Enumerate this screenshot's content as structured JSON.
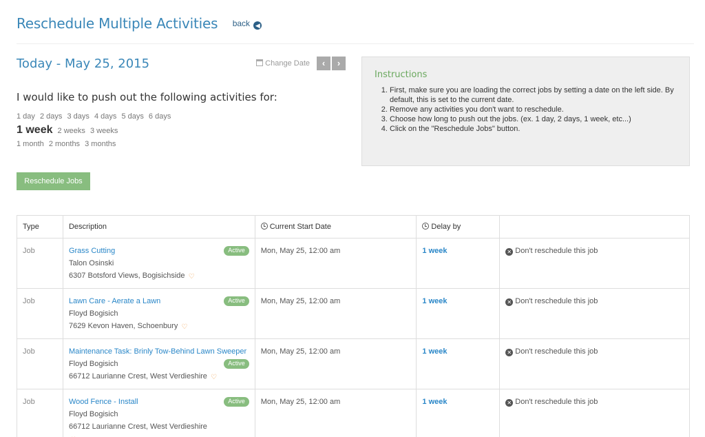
{
  "header": {
    "title": "Reschedule Multiple Activities",
    "back_label": "back"
  },
  "date_section": {
    "title": "Today - May 25, 2015",
    "change_date_label": "Change Date",
    "prev_glyph": "‹",
    "next_glyph": "›"
  },
  "prompt": "I would like to push out the following activities for:",
  "delay_options": {
    "days": [
      "1 day",
      "2 days",
      "3 days",
      "4 days",
      "5 days",
      "6 days"
    ],
    "weeks": [
      "1 week",
      "2 weeks",
      "3 weeks"
    ],
    "months": [
      "1 month",
      "2 months",
      "3 months"
    ],
    "selected": "1 week"
  },
  "reschedule_button": "Reschedule Jobs",
  "instructions": {
    "title": "Instructions",
    "steps": [
      "First, make sure you are loading the correct jobs by setting a date on the left side. By default, this is set to the current date.",
      "Remove any activities you don't want to reschedule.",
      "Choose how long to push out the jobs. (ex. 1 day, 2 days, 1 week, etc...)",
      "Click on the \"Reschedule Jobs\" button."
    ]
  },
  "table": {
    "headers": {
      "type": "Type",
      "description": "Description",
      "start": "Current Start Date",
      "delay": "Delay by"
    },
    "rows": [
      {
        "type": "Job",
        "title": "Grass Cutting",
        "status": "Active",
        "client": "Talon Osinski",
        "address": "6307 Botsford Views, Bogisichside",
        "start": "Mon, May 25, 12:00 am",
        "delay": "1 week",
        "skip_label": "Don't reschedule this job"
      },
      {
        "type": "Job",
        "title": "Lawn Care - Aerate a Lawn",
        "status": "Active",
        "client": "Floyd Bogisich",
        "address": "7629 Kevon Haven, Schoenbury",
        "start": "Mon, May 25, 12:00 am",
        "delay": "1 week",
        "skip_label": "Don't reschedule this job"
      },
      {
        "type": "Job",
        "title": "Maintenance Task: Brinly Tow-Behind Lawn Sweeper",
        "status": "Active",
        "client": "Floyd Bogisich",
        "address": "66712 Laurianne Crest, West Verdieshire",
        "start": "Mon, May 25, 12:00 am",
        "delay": "1 week",
        "skip_label": "Don't reschedule this job"
      },
      {
        "type": "Job",
        "title": "Wood Fence - Install",
        "status": "Active",
        "client": "Floyd Bogisich",
        "address": "66712 Laurianne Crest, West Verdieshire",
        "start": "Mon, May 25, 12:00 am",
        "delay": "1 week",
        "skip_label": "Don't reschedule this job"
      }
    ]
  }
}
